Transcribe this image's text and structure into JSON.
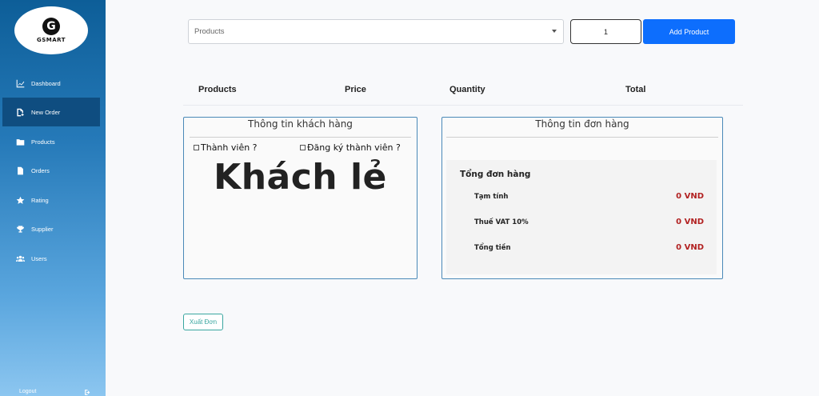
{
  "brand": {
    "logo_letter": "G",
    "logo_text": "GSMART"
  },
  "sidebar": {
    "items": [
      {
        "label": "Dashboard",
        "icon": "chart-line-icon"
      },
      {
        "label": "New Order",
        "icon": "file-plus-icon",
        "active": true
      },
      {
        "label": "Products",
        "icon": "folder-icon"
      },
      {
        "label": "Orders",
        "icon": "file-icon"
      },
      {
        "label": "Rating",
        "icon": "star-icon"
      },
      {
        "label": "Supplier",
        "icon": "trophy-icon"
      },
      {
        "label": "Users",
        "icon": "users-icon"
      }
    ],
    "logout_label": "Logout"
  },
  "toolbar": {
    "product_select_value": "Products",
    "quantity_value": "1",
    "add_button_label": "Add Product"
  },
  "table": {
    "headers": [
      "Products",
      "Price",
      "Quantity",
      "Total"
    ]
  },
  "customer_panel": {
    "title": "Thông tin khách hàng",
    "member_label": "Thành viên ?",
    "register_label": "Đăng ký thành viên ?",
    "guest_label": "Khách lẻ"
  },
  "order_panel": {
    "title": "Thông tin đơn hàng",
    "summary_title": "Tổng đơn hàng",
    "subtotal_label": "Tạm tính",
    "subtotal_value": "0 VND",
    "vat_label": "Thuế VAT 10%",
    "vat_value": "0 VND",
    "total_label": "Tổng tiền",
    "total_value": "0 VND"
  },
  "export_button_label": "Xuất Đơn",
  "colors": {
    "primary": "#0d6efd",
    "sidebar_active": "#0f4d80",
    "money": "#b22222",
    "export": "#3aa6a0"
  }
}
